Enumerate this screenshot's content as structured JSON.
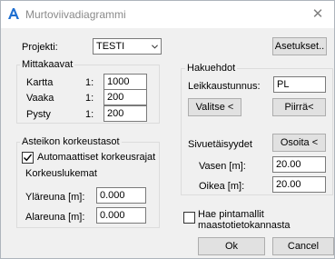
{
  "window": {
    "title": "Murtoviivadiagrammi"
  },
  "project": {
    "label": "Projekti:",
    "value": "TESTI"
  },
  "settings_button": "Asetukset..",
  "scales": {
    "legend": "Mittakaavat",
    "prefix": "1:",
    "rows": [
      {
        "label": "Kartta",
        "value": "1000"
      },
      {
        "label": "Vaaka",
        "value": "200"
      },
      {
        "label": "Pysty",
        "value": "200"
      }
    ]
  },
  "search": {
    "legend": "Hakuehdot",
    "section_label": "Leikkaustunnus:",
    "section_value": "PL",
    "select_button": "Valitse <",
    "draw_button": "Piirrä<",
    "offsets_label": "Sivuetäisyydet",
    "point_button": "Osoita <",
    "left_label": "Vasen [m]:",
    "left_value": "20.00",
    "right_label": "Oikea [m]:",
    "right_value": "20.00"
  },
  "heights": {
    "legend": "Asteikon korkeustasot",
    "auto_label": "Automaattiset korkeusrajat",
    "auto_checked": true,
    "levels_label": "Korkeuslukemat",
    "upper_label": "Yläreuna [m]:",
    "upper_value": "0.000",
    "lower_label": "Alareuna [m]:",
    "lower_value": "0.000"
  },
  "surface_option": {
    "label_line1": "Hae pintamallit",
    "label_line2": "maastotietokannasta",
    "checked": false
  },
  "ok_button": "Ok",
  "cancel_button": "Cancel",
  "colors": {
    "accent": "#1e6fd1"
  }
}
